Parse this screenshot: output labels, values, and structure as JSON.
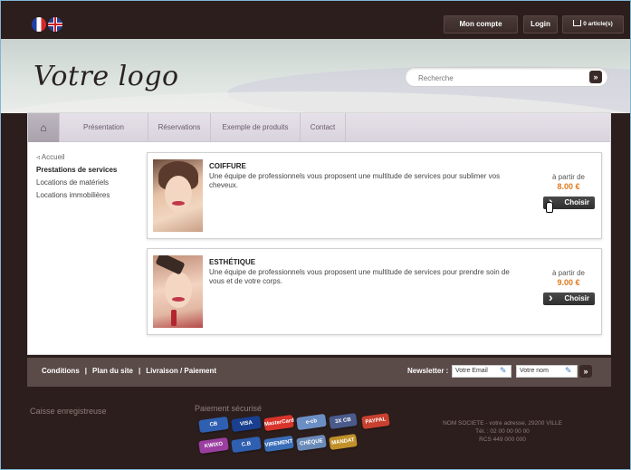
{
  "topbar": {
    "account_label": "Mon compte",
    "login_label": "Login",
    "cart_label": "0 article(s)"
  },
  "header": {
    "logo": "Votre logo",
    "search_placeholder": "Recherche",
    "search_button": "»"
  },
  "nav": {
    "items": [
      {
        "label": "Présentation"
      },
      {
        "label": "Réservations"
      },
      {
        "label": "Exemple de produits"
      },
      {
        "label": "Contact"
      }
    ]
  },
  "sidebar": {
    "back_label": "Accueil",
    "items": [
      {
        "label": "Prestations de services"
      },
      {
        "label": "Locations de matériels"
      },
      {
        "label": "Locations immobilières"
      }
    ]
  },
  "products": [
    {
      "title": "COIFFURE",
      "description": "Une équipe de professionnels vous proposent une multitude de services pour sublimer vos cheveux.",
      "price_label": "à partir de",
      "price": "8.00 €",
      "button": "Choisir"
    },
    {
      "title": "ESTHÉTIQUE",
      "description": "Une équipe de professionnels vous proposent une multitude de services pour prendre soin de vous et de votre corps.",
      "price_label": "à partir de",
      "price": "9.00 €",
      "button": "Choisir"
    }
  ],
  "footer": {
    "links": [
      "Conditions",
      "Plan du site",
      "Livraison / Paiement"
    ],
    "separator": "|",
    "newsletter_label": "Newsletter :",
    "email_placeholder": "Votre Email",
    "name_placeholder": "Votre nom",
    "newsletter_button": "»",
    "caisse": "Caisse enregistreuse",
    "payment_title": "Paiement sécurisé",
    "payment_methods": [
      "CB",
      "VISA",
      "MasterCard",
      "e-cb",
      "3X CB",
      "PAYPAL",
      "KWIXO",
      "C.B",
      "VIREMENT",
      "CHÈQUE",
      "MANDAT"
    ],
    "company_line1": "NOM SOCIETE - votre adresse, 29200 VILLE",
    "company_line2": "Tél. : 02 00 00 00 00",
    "company_line3": "RCS 449 000 000"
  },
  "colors": {
    "dark_bg": "#2c1e1c",
    "price_accent": "#e07a1e",
    "footer_bar": "#5a4b49"
  }
}
